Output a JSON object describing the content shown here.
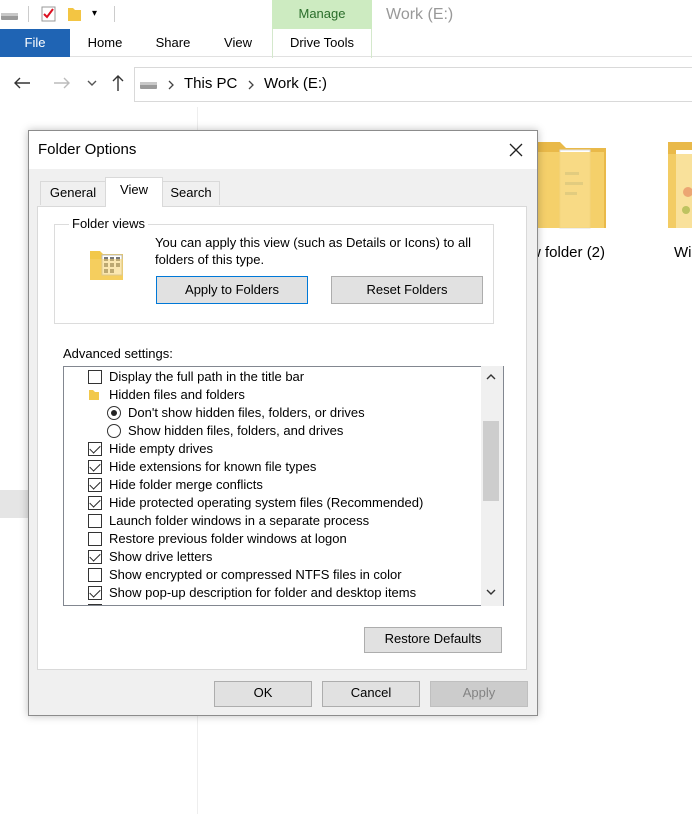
{
  "explorer": {
    "window_title": "Work (E:)",
    "ribbon": {
      "file": "File",
      "tabs": [
        "Home",
        "Share",
        "View",
        "Drive Tools"
      ],
      "contextual_group": "Manage"
    },
    "address": {
      "crumbs": [
        "This PC",
        "Work (E:)"
      ]
    },
    "items": [
      {
        "name": "w folder (2)"
      },
      {
        "name": "Wi"
      }
    ]
  },
  "dialog": {
    "title": "Folder Options",
    "tabs": [
      "General",
      "View",
      "Search"
    ],
    "active_tab": "View",
    "folder_views": {
      "legend": "Folder views",
      "description": "You can apply this view (such as Details or Icons) to all folders of this type.",
      "apply_button": "Apply to Folders",
      "reset_button": "Reset Folders"
    },
    "advanced": {
      "label": "Advanced settings:",
      "items": [
        {
          "type": "checkbox",
          "checked": false,
          "label": "Display the full path in the title bar"
        },
        {
          "type": "folder",
          "label": "Hidden files and folders"
        },
        {
          "type": "radio",
          "checked": true,
          "label": "Don't show hidden files, folders, or drives"
        },
        {
          "type": "radio",
          "checked": false,
          "label": "Show hidden files, folders, and drives"
        },
        {
          "type": "checkbox",
          "checked": true,
          "label": "Hide empty drives"
        },
        {
          "type": "checkbox",
          "checked": true,
          "label": "Hide extensions for known file types"
        },
        {
          "type": "checkbox",
          "checked": true,
          "label": "Hide folder merge conflicts"
        },
        {
          "type": "checkbox",
          "checked": true,
          "label": "Hide protected operating system files (Recommended)"
        },
        {
          "type": "checkbox",
          "checked": false,
          "label": "Launch folder windows in a separate process"
        },
        {
          "type": "checkbox",
          "checked": false,
          "label": "Restore previous folder windows at logon"
        },
        {
          "type": "checkbox",
          "checked": true,
          "label": "Show drive letters"
        },
        {
          "type": "checkbox",
          "checked": false,
          "label": "Show encrypted or compressed NTFS files in color"
        },
        {
          "type": "checkbox",
          "checked": true,
          "label": "Show pop-up description for folder and desktop items"
        }
      ]
    },
    "restore_defaults": "Restore Defaults",
    "ok": "OK",
    "cancel": "Cancel",
    "apply": "Apply"
  }
}
